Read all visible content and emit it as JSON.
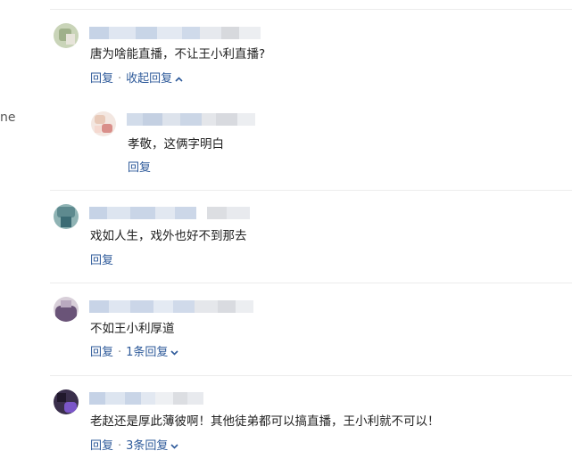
{
  "edge_text": "ne",
  "comments": [
    {
      "text": "唐为啥能直播，不让王小利直播?",
      "reply": "回复",
      "collapse": "收起回复",
      "reply_item": {
        "text": "孝敬，这俩字明白",
        "reply": "回复"
      }
    },
    {
      "text": "戏如人生，戏外也好不到那去",
      "reply": "回复"
    },
    {
      "text": "不如王小利厚道",
      "reply": "回复",
      "more_replies": "1条回复"
    },
    {
      "text": "老赵还是厚此薄彼啊！其他徒弟都可以搞直播，王小利就不可以！",
      "reply": "回复",
      "more_replies": "3条回复"
    }
  ],
  "separator": "·",
  "icons": {
    "collapse": "chevron-up-icon",
    "expand": "chevron-down-icon"
  },
  "colors": {
    "link": "#2e5a9a",
    "text": "#222222",
    "divider": "#ececec"
  }
}
